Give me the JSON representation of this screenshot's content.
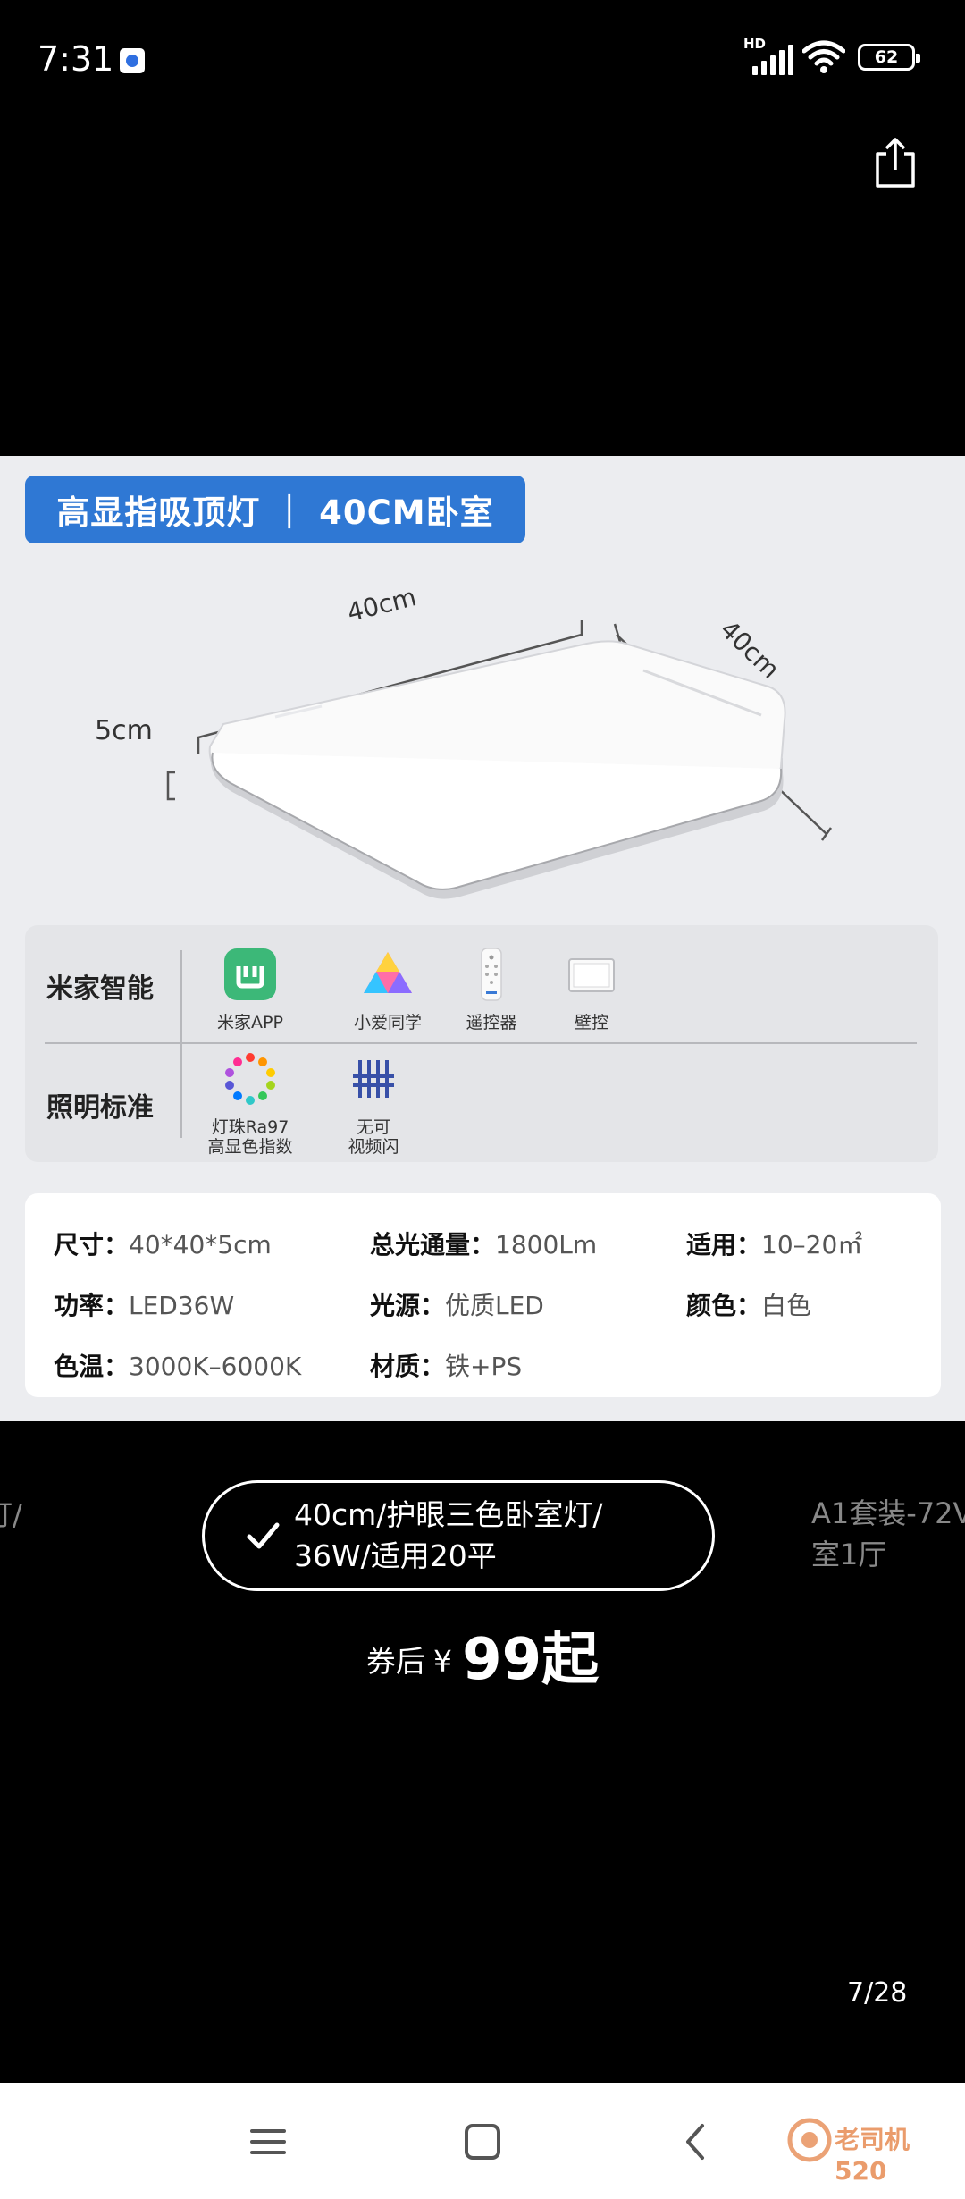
{
  "status_bar": {
    "time": "7:31",
    "network_label": "HD",
    "battery_level": "62",
    "icons": [
      "app-notification-icon",
      "signal-icon",
      "wifi-icon",
      "battery-icon"
    ]
  },
  "toolbar": {
    "share_icon": "share-icon"
  },
  "product_image": {
    "title_banner": "高显指吸顶灯 ｜ 40CM卧室",
    "dim_width": "40cm",
    "dim_depth": "40cm",
    "dim_height": "5cm",
    "features": {
      "smart_label": "米家智能",
      "smart_items": [
        {
          "label": "米家APP",
          "icon": "mijia-app-icon"
        },
        {
          "label": "小爱同学",
          "icon": "xiaoai-icon"
        },
        {
          "label": "遥控器",
          "icon": "remote-control-icon"
        },
        {
          "label": "壁控",
          "icon": "wall-switch-icon"
        }
      ],
      "lighting_label": "照明标准",
      "lighting_items": [
        {
          "line1": "灯珠Ra97",
          "line2": "高显色指数",
          "icon": "color-ring-icon"
        },
        {
          "line1": "无可",
          "line2": "视频闪",
          "icon": "no-flicker-icon"
        }
      ]
    },
    "specs": [
      {
        "key": "尺寸：",
        "value": "40*40*5cm"
      },
      {
        "key": "总光通量：",
        "value": "1800Lm"
      },
      {
        "key": "适用：",
        "value": "10–20㎡"
      },
      {
        "key": "功率：",
        "value": "LED36W"
      },
      {
        "key": "光源：",
        "value": "优质LED"
      },
      {
        "key": "颜色：",
        "value": "白色"
      },
      {
        "key": "色温：",
        "value": "3000K–6000K"
      },
      {
        "key": "材质：",
        "value": "铁+PS"
      }
    ]
  },
  "variants": {
    "left_partial": "灯/",
    "selected_line1": "40cm/护眼三色卧室灯/",
    "selected_line2": "36W/适用20平",
    "right_partial_line1": "A1套装-72V",
    "right_partial_line2": "室1厅"
  },
  "price": {
    "prefix": "券后",
    "currency": "¥",
    "value": "99起"
  },
  "pager": {
    "counter": "7/28"
  },
  "nav": {
    "icons": [
      "menu-icon",
      "home-icon",
      "back-icon"
    ],
    "watermark": "老司机520"
  }
}
